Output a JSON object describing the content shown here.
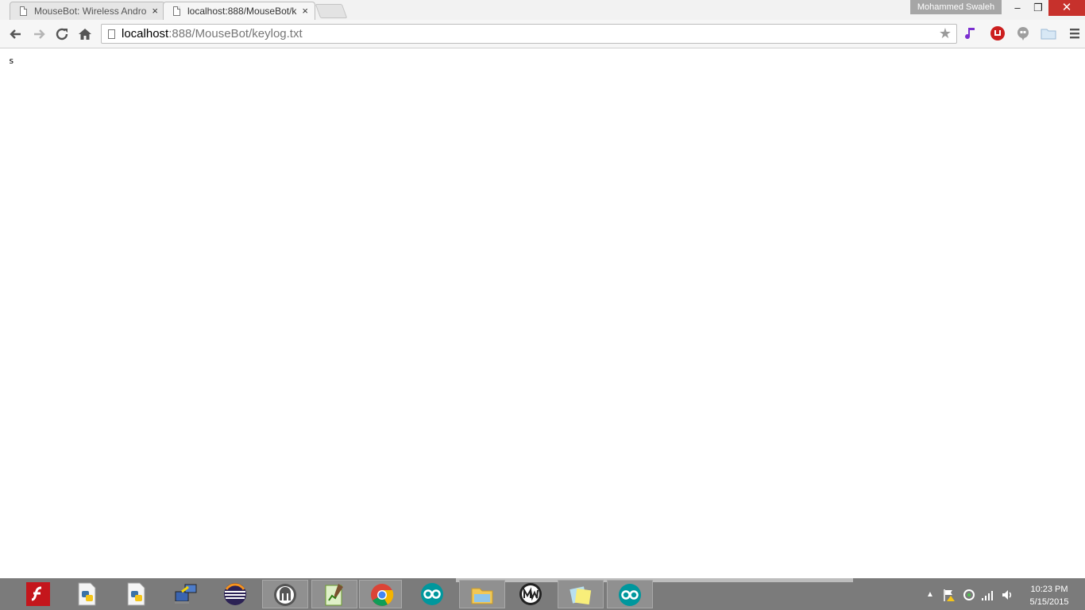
{
  "browser": {
    "tabs": [
      {
        "title": "MouseBot: Wireless Andro",
        "active": false
      },
      {
        "title": "localhost:888/MouseBot/k",
        "active": true
      }
    ],
    "tab_close_glyph": "×",
    "profile_name": "Mohammed Swaleh",
    "window_controls": {
      "minimize": "–",
      "restore": "❐",
      "close": "✕"
    },
    "url_host": "localhost",
    "url_rest": ":888/MouseBot/keylog.txt",
    "extensions": [
      "music-note-icon",
      "adblock-icon",
      "hangouts-icon",
      "folder-icon",
      "menu-icon"
    ]
  },
  "page": {
    "text": "s"
  },
  "taskbar": {
    "apps": [
      {
        "name": "flash-app-icon",
        "running": false
      },
      {
        "name": "python-file-icon",
        "running": false
      },
      {
        "name": "python-file-icon",
        "running": false
      },
      {
        "name": "network-app-icon",
        "running": false
      },
      {
        "name": "eclipse-icon",
        "running": false
      },
      {
        "name": "bluestacks-icon",
        "running": true
      },
      {
        "name": "notepad-plus-plus-icon",
        "running": true
      },
      {
        "name": "chrome-icon",
        "running": true
      },
      {
        "name": "arduino-icon",
        "running": false
      },
      {
        "name": "file-explorer-icon",
        "running": true
      },
      {
        "name": "mw-app-icon",
        "running": false
      },
      {
        "name": "sticky-notes-icon",
        "running": true
      },
      {
        "name": "arduino-icon",
        "running": true
      }
    ],
    "clock_time": "10:23 PM",
    "clock_date": "5/15/2015"
  },
  "colors": {
    "close_button": "#c7312c",
    "taskbar": "#7b7b7b",
    "profile_badge": "#a6a6a6"
  }
}
